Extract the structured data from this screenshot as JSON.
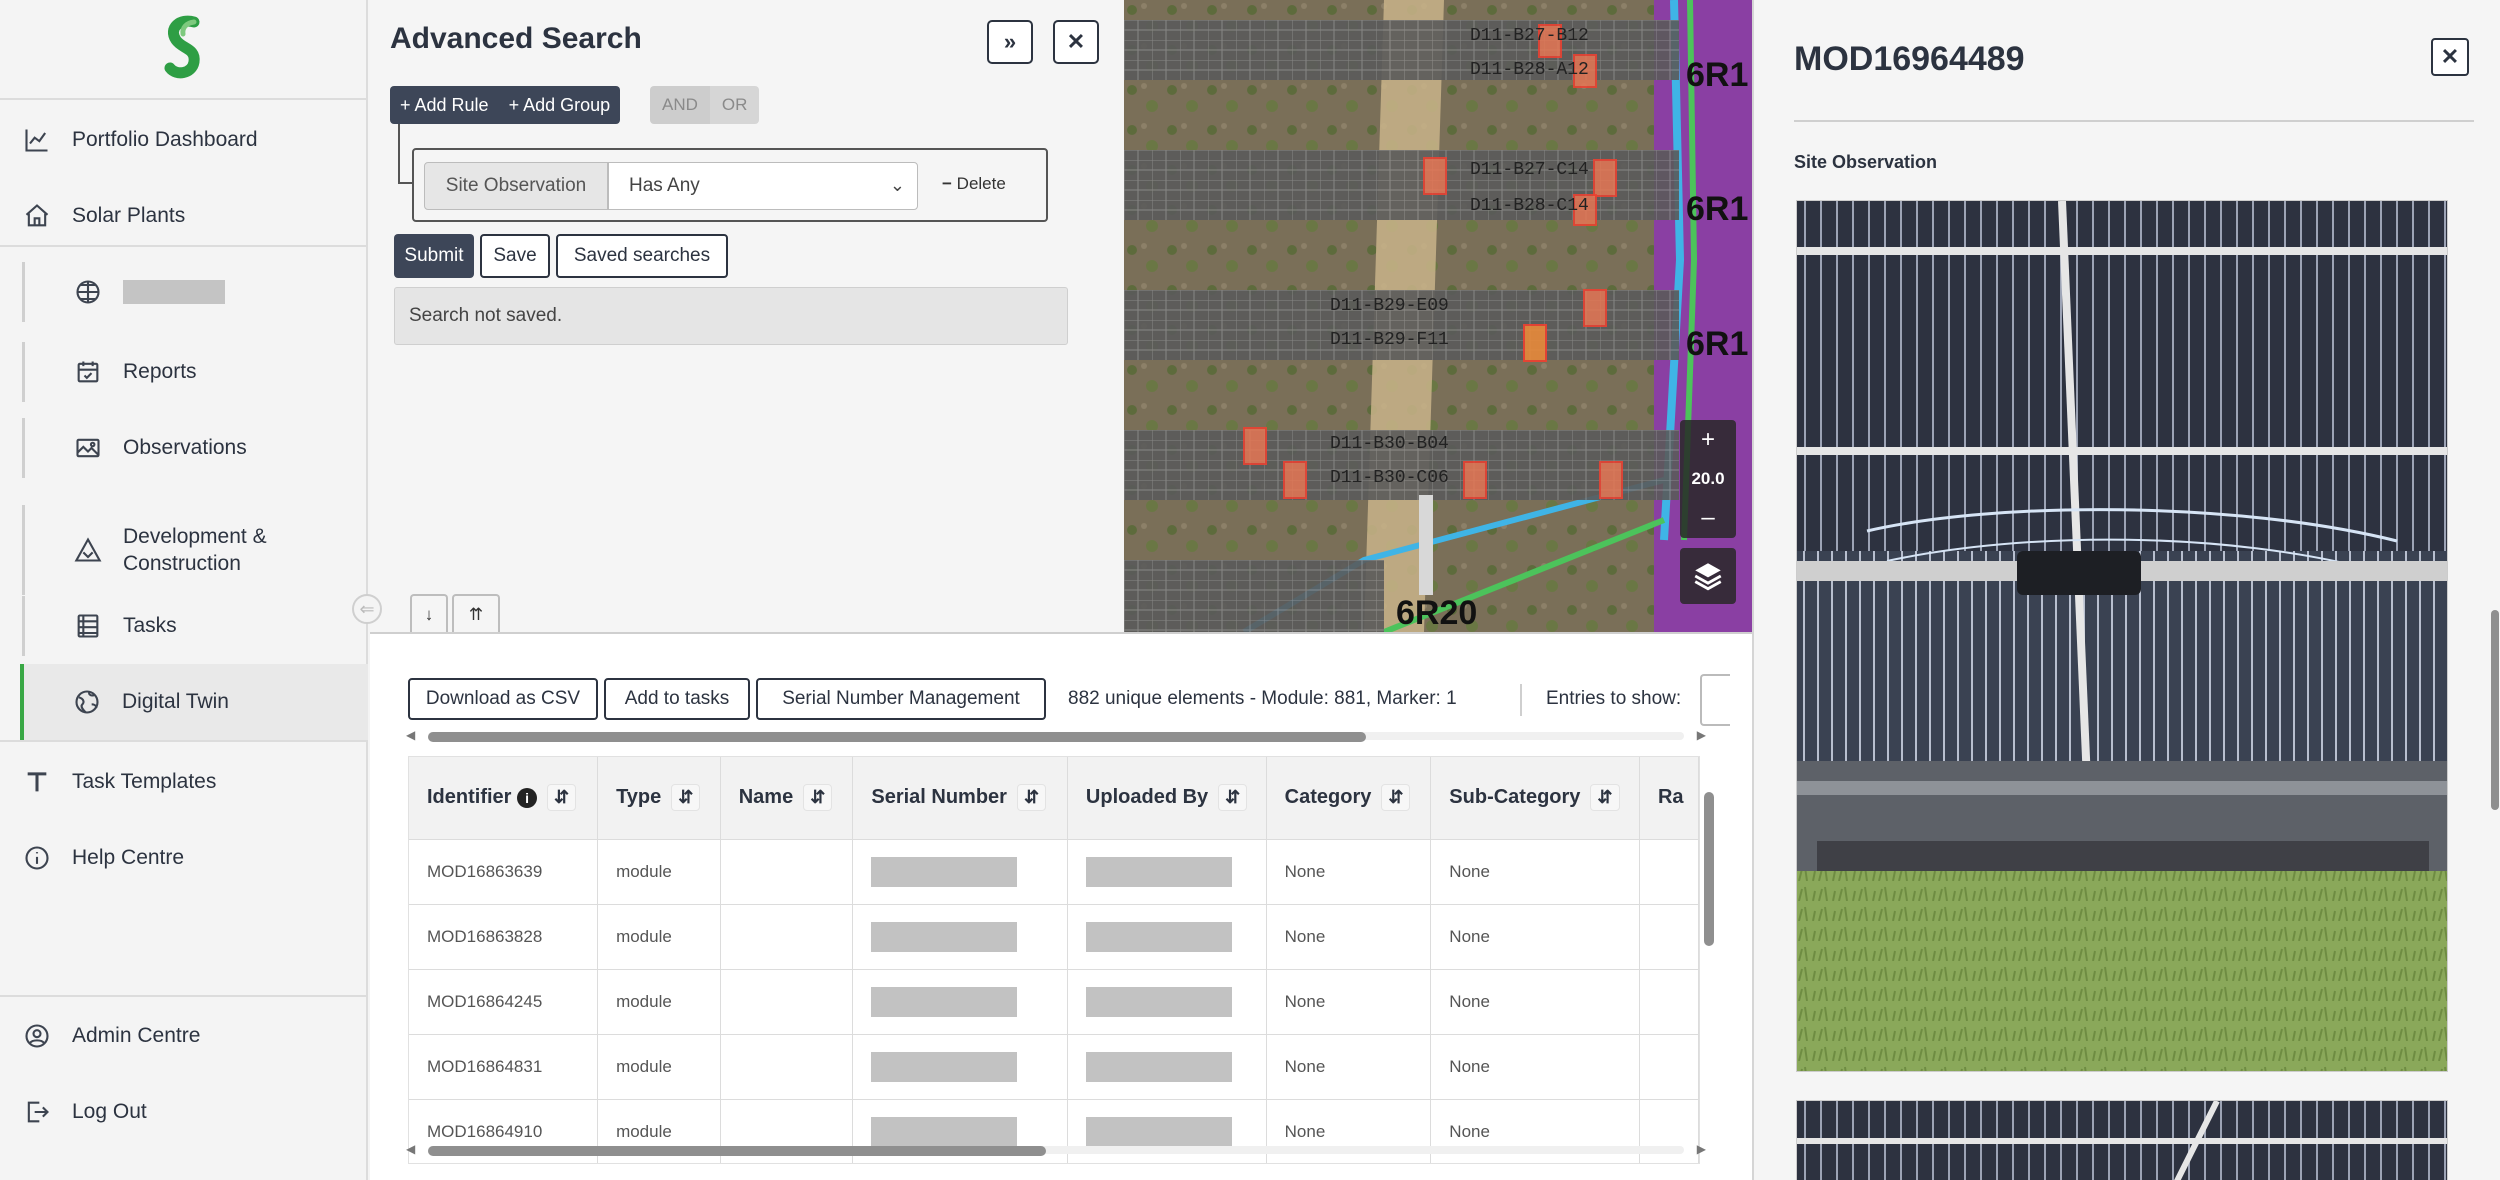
{
  "sidebar": {
    "items": [
      {
        "label": "Portfolio Dashboard",
        "icon": "chart-line-icon"
      },
      {
        "label": "Solar Plants",
        "icon": "home-icon"
      },
      {
        "label": "",
        "icon": "grid-icon",
        "redacted": true
      },
      {
        "label": "Reports",
        "icon": "calendar-check-icon"
      },
      {
        "label": "Observations",
        "icon": "image-icon"
      },
      {
        "label": "Development & Construction",
        "icon": "hazard-icon"
      },
      {
        "label": "Tasks",
        "icon": "list-icon"
      },
      {
        "label": "Digital Twin",
        "icon": "globe-icon",
        "active": true
      },
      {
        "label": "Task Templates",
        "icon": "text-t-icon"
      },
      {
        "label": "Help Centre",
        "icon": "info-circle-icon"
      },
      {
        "label": "Admin Centre",
        "icon": "user-circle-icon"
      },
      {
        "label": "Log Out",
        "icon": "logout-icon"
      }
    ],
    "accent": "#39a845"
  },
  "search": {
    "title": "Advanced Search",
    "expand_label": "»",
    "close_label": "✕",
    "add_rule": "+ Add Rule",
    "add_group": "+ Add Group",
    "and_label": "AND",
    "or_label": "OR",
    "rule": {
      "field": "Site Observation",
      "operator": "Has Any",
      "delete_label": "Delete"
    },
    "submit_label": "Submit",
    "save_label": "Save",
    "saved_searches_label": "Saved searches",
    "status": "Search not saved."
  },
  "tabs": {
    "down_label": "↓",
    "up_label": "⇈",
    "collapse_label": "⇐"
  },
  "map": {
    "zoom_in": "+",
    "zoom_value": "20.0",
    "zoom_out": "–",
    "row_labels": [
      "6R1",
      "6R1",
      "6R1",
      "6R20"
    ],
    "block_labels": [
      "D11-B27-B12",
      "D11-B28-A12",
      "D11-B27-C14",
      "D11-B28-C14",
      "D11-B29-E09",
      "D11-B29-F11",
      "D11-B30-B04",
      "D11-B30-C06"
    ]
  },
  "toolbar": {
    "download_csv": "Download as CSV",
    "add_to_tasks": "Add to tasks",
    "serial_mgmt": "Serial Number Management",
    "count": "882 unique elements - Module: 881, Marker: 1",
    "entries_label": "Entries to show:"
  },
  "table": {
    "columns": [
      "Identifier",
      "Type",
      "Name",
      "Serial Number",
      "Uploaded By",
      "Category",
      "Sub-Category",
      "Ra"
    ],
    "rows": [
      [
        "MOD16863639",
        "module",
        "",
        "",
        "",
        "None",
        "None",
        ""
      ],
      [
        "MOD16863828",
        "module",
        "",
        "",
        "",
        "None",
        "None",
        ""
      ],
      [
        "MOD16864245",
        "module",
        "",
        "",
        "",
        "None",
        "None",
        ""
      ],
      [
        "MOD16864831",
        "module",
        "",
        "",
        "",
        "None",
        "None",
        ""
      ],
      [
        "MOD16864910",
        "module",
        "",
        "",
        "",
        "None",
        "None",
        ""
      ]
    ]
  },
  "detail": {
    "title": "MOD16964489",
    "close_label": "✕",
    "section_label": "Site Observation"
  }
}
